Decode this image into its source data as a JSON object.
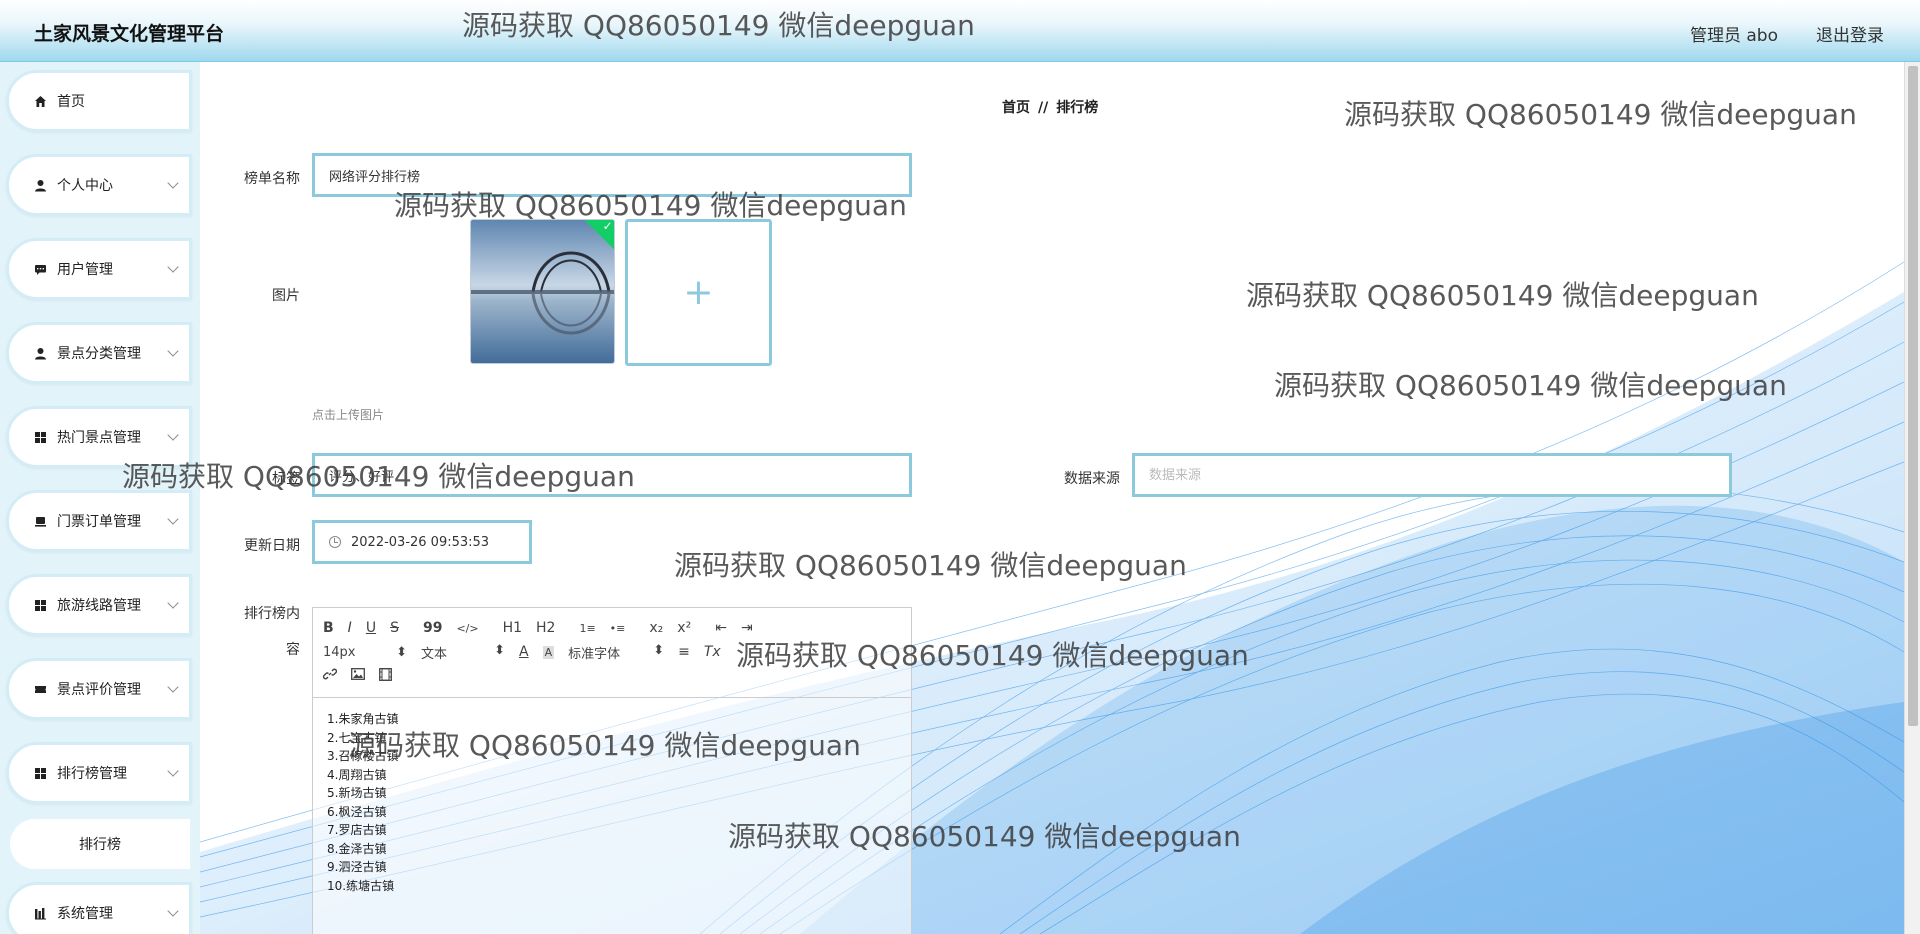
{
  "app": {
    "title": "土家风景文化管理平台"
  },
  "header": {
    "user_label": "管理员 abo",
    "logout_label": "退出登录"
  },
  "sidebar": {
    "items": [
      {
        "label": "首页",
        "icon": "home-icon"
      },
      {
        "label": "个人中心",
        "icon": "user-icon"
      },
      {
        "label": "用户管理",
        "icon": "chat-icon"
      },
      {
        "label": "景点分类管理",
        "icon": "user-icon"
      },
      {
        "label": "热门景点管理",
        "icon": "grid-icon"
      },
      {
        "label": "门票订单管理",
        "icon": "ticket-icon"
      },
      {
        "label": "旅游线路管理",
        "icon": "grid-icon"
      },
      {
        "label": "景点评价管理",
        "icon": "ticket-icon"
      },
      {
        "label": "排行榜管理",
        "icon": "grid-icon"
      },
      {
        "label": "系统管理",
        "icon": "chart-icon"
      }
    ],
    "submenu": {
      "label": "排行榜"
    }
  },
  "breadcrumb": {
    "home": "首页",
    "separator": "//",
    "current": "排行榜"
  },
  "form": {
    "name_label": "榜单名称",
    "name_value": "网络评分排行榜",
    "image_label": "图片",
    "upload_tip": "点击上传图片",
    "upload_add": "+",
    "tags_label": "标签",
    "tags_value": "评分、好评",
    "source_label": "数据来源",
    "source_placeholder": "数据来源",
    "date_label": "更新日期",
    "date_value": "2022-03-26 09:53:53",
    "content_label_1": "排行榜内",
    "content_label_2": "容"
  },
  "editor": {
    "toolbar_row1": [
      "B",
      "I",
      "U",
      "S",
      "99",
      "</>",
      "H1",
      "H2",
      "1≡",
      "•≡",
      "x₂",
      "x²",
      "⇤",
      "⇥"
    ],
    "font_size": "14px",
    "text_type": "文本",
    "font_family": "标准字体",
    "content_lines": [
      "1.朱家角古镇",
      "2.七宝古镇",
      "3.召稼楼古镇",
      "4.周翔古镇",
      "5.新场古镇",
      "6.枫泾古镇",
      "7.罗店古镇",
      "8.金泽古镇",
      "9.泗泾古镇",
      "10.练塘古镇"
    ]
  },
  "watermark": {
    "text": "源码获取 QQ86050149 微信deepguan"
  },
  "colors": {
    "accent": "#8cc9dc",
    "sidebar_bg": "#e3f3fa",
    "header_gradient_end": "#9fd8ee",
    "wave_blue": "#1e88e5"
  }
}
